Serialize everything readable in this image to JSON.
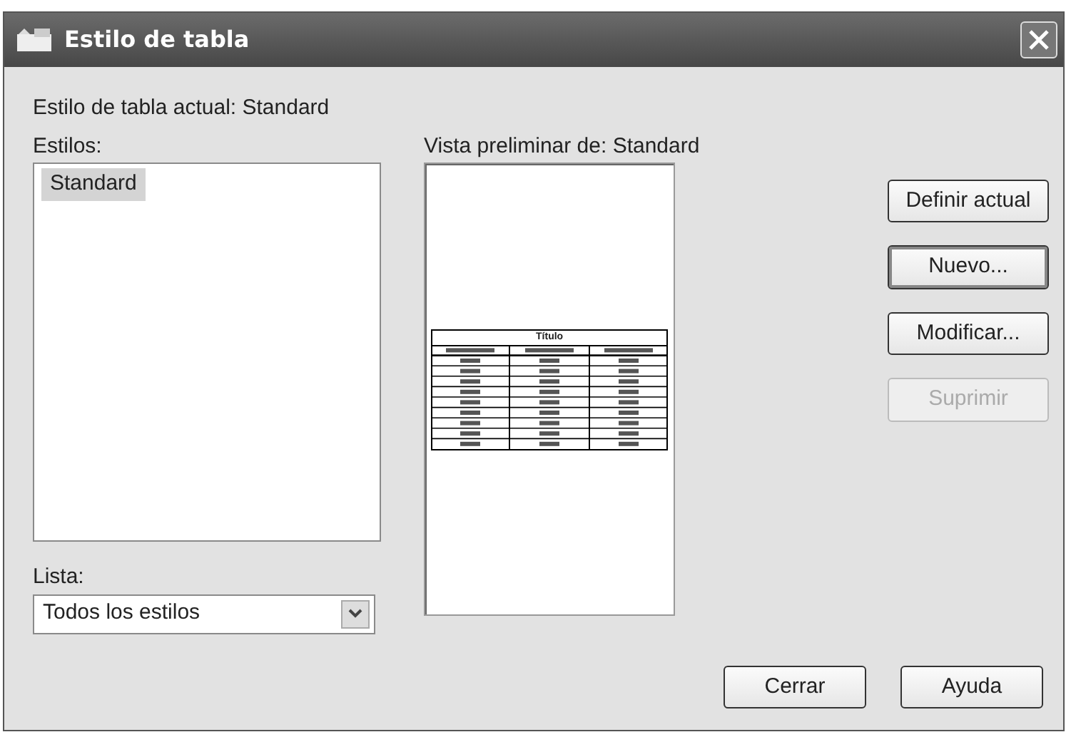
{
  "window": {
    "title": "Estilo de tabla"
  },
  "current_style": "Estilo de tabla actual: Standard",
  "styles": {
    "label": "Estilos:",
    "items": [
      {
        "label": "Standard",
        "selected": true
      }
    ]
  },
  "list_filter": {
    "label": "Lista:",
    "value": "Todos los estilos"
  },
  "preview": {
    "label": "Vista preliminar de: Standard",
    "table_title": "Título"
  },
  "side_buttons": [
    {
      "label": "Definir actual",
      "disabled": false,
      "focused": false
    },
    {
      "label": "Nuevo...",
      "disabled": false,
      "focused": true
    },
    {
      "label": "Modificar...",
      "disabled": false,
      "focused": false
    },
    {
      "label": "Suprimir",
      "disabled": true,
      "focused": false
    }
  ],
  "footer_buttons": [
    {
      "label": "Cerrar",
      "disabled": false,
      "focused": false
    },
    {
      "label": "Ayuda",
      "disabled": false,
      "focused": false
    }
  ]
}
